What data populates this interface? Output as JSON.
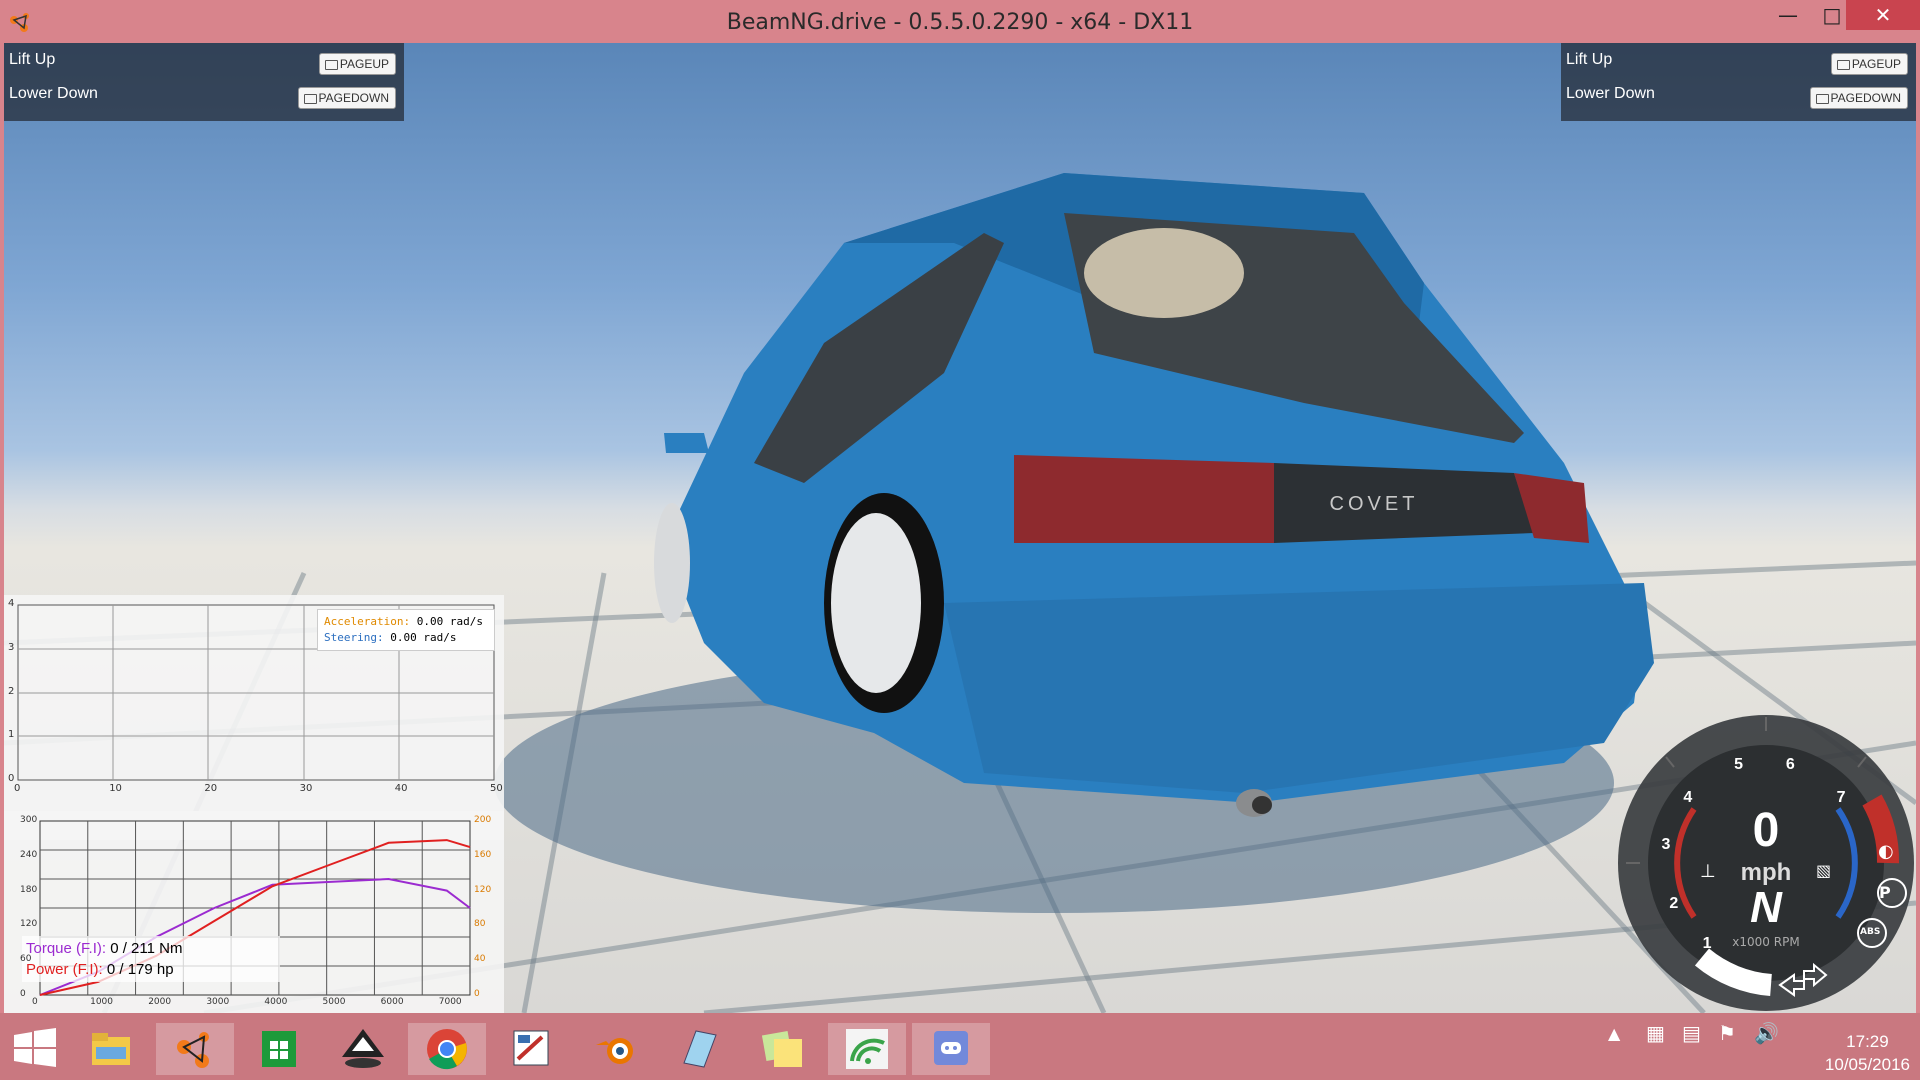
{
  "window": {
    "title": "BeamNG.drive - 0.5.5.0.2290 - x64 - DX11"
  },
  "panel_left": {
    "lift_label": "Lift Up",
    "lift_key": "PAGEUP",
    "lower_label": "Lower Down",
    "lower_key": "PAGEDOWN"
  },
  "panel_right": {
    "lift_label": "Lift Up",
    "lift_key": "PAGEUP",
    "lower_label": "Lower Down",
    "lower_key": "PAGEDOWN"
  },
  "car": {
    "badge": "COVET"
  },
  "accel_graph": {
    "legend": {
      "accel_label": "Acceleration:",
      "accel_value": "0.00 rad/s",
      "steer_label": "Steering:",
      "steer_value": "0.00 rad/s"
    },
    "x_ticks": [
      "0",
      "10",
      "20",
      "30",
      "40",
      "50"
    ],
    "y_ticks": [
      "0",
      "1",
      "2",
      "3",
      "4"
    ]
  },
  "engine_graph": {
    "left_ticks": [
      "0",
      "60",
      "120",
      "180",
      "240",
      "300"
    ],
    "right_ticks": [
      "0",
      "40",
      "80",
      "120",
      "160",
      "200"
    ],
    "x_ticks": [
      "0",
      "1000",
      "2000",
      "3000",
      "4000",
      "5000",
      "6000",
      "7000"
    ],
    "torque_label": "Torque (F.I):",
    "torque_value": "0 / 211 Nm",
    "power_label": "Power (F.I):",
    "power_value": "0 / 179 hp"
  },
  "chart_data": {
    "type": "line",
    "x": [
      0,
      1000,
      2000,
      3000,
      4000,
      5000,
      6000,
      7000,
      7400
    ],
    "ylim_left": [
      0,
      300
    ],
    "ylim_right": [
      0,
      200
    ],
    "series": [
      {
        "name": "Torque (F.I)",
        "color": "#9b2bd0",
        "values": [
          0,
          40,
          100,
          150,
          190,
          195,
          200,
          180,
          150
        ]
      },
      {
        "name": "Power (F.I)",
        "color": "#e02020",
        "values": [
          0,
          15,
          45,
          85,
          125,
          150,
          175,
          178,
          170
        ]
      }
    ]
  },
  "gauge": {
    "speed": "0",
    "unit": "mph",
    "gear": "N",
    "rpm_label": "x1000 RPM",
    "ticks": [
      "1",
      "2",
      "3",
      "4",
      "5",
      "6",
      "7"
    ]
  },
  "taskbar": {
    "apps": [
      "start-button",
      "file-explorer",
      "beamng",
      "store",
      "inkscape",
      "chrome",
      "paint",
      "blender",
      "notepad",
      "sticky-notes",
      "wifi-tool",
      "discord"
    ],
    "time": "17:29",
    "date": "10/05/2016"
  },
  "colors": {
    "titlebar": "#d8848c",
    "close": "#c9444f",
    "car": "#2a7fc0",
    "torque": "#9b2bd0",
    "power": "#e02020"
  }
}
